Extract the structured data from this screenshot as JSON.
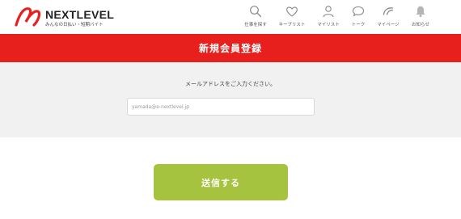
{
  "brand": {
    "name": "NEXTLEVEL",
    "tagline": "みんなの日払い・短期バイト",
    "accent": "#e8201d"
  },
  "nav": [
    {
      "label": "仕事を探す",
      "icon": "search-icon"
    },
    {
      "label": "キープリスト",
      "icon": "heart-icon"
    },
    {
      "label": "マイリスト",
      "icon": "person-icon"
    },
    {
      "label": "トーク",
      "icon": "chat-bubble-icon"
    },
    {
      "label": "マイページ",
      "icon": "gauge-icon"
    },
    {
      "label": "お知らせ",
      "icon": "bell-icon"
    }
  ],
  "page": {
    "title": "新規会員登録"
  },
  "form": {
    "instruction": "メールアドレスをご入力ください。",
    "email_placeholder": "yamada@e-nextlevel.jp",
    "email_value": ""
  },
  "submit": {
    "label": "送信する",
    "color": "#a6c33f"
  }
}
